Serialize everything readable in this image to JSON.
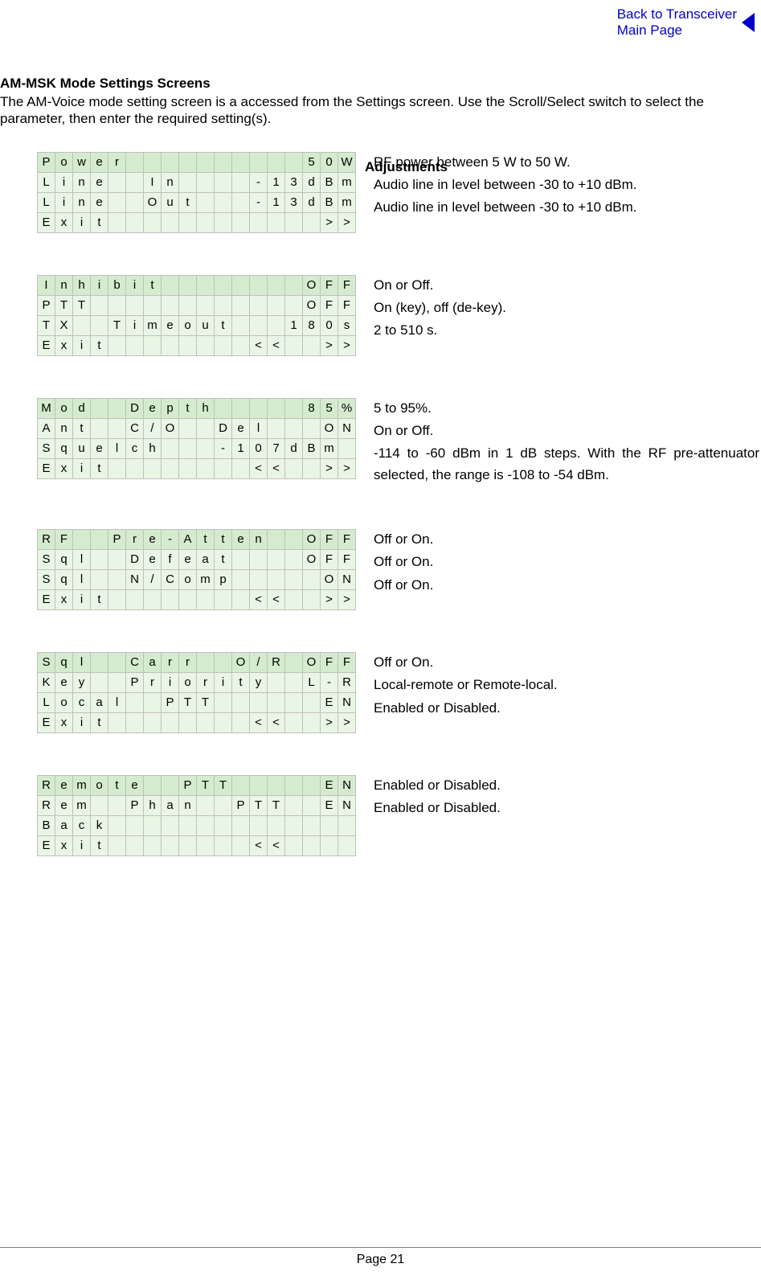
{
  "nav": {
    "back_line1": "Back to Transceiver",
    "back_line2": "Main Page"
  },
  "header": {
    "title": "AM-MSK Mode Settings Screens",
    "intro": "The AM-Voice mode setting screen is a accessed from the Settings screen. Use the Scroll/Select switch to select the parameter, then enter the required setting(s)."
  },
  "adjustments_label": "Adjustments",
  "screens": [
    {
      "rows": [
        "Power          50W",
        "Line  In    -13dBm",
        "Line  Out   -13dBm",
        "Exit            >>"
      ],
      "desc": [
        "RF power between 5 W to 50 W.",
        "Audio line in level between -30 to +10 dBm.",
        "Audio line in level between -30 to +10 dBm."
      ]
    },
    {
      "rows": [
        "Inhibit        OFF",
        "PTT            OFF",
        "TX  Timeout   180s",
        "Exit        <<  >>"
      ],
      "desc": [
        "On or Off.",
        "On (key), off (de-key).",
        "2 to 510 s."
      ]
    },
    {
      "rows": [
        "Mod  Depth     85%",
        "Ant  C/O  Del   ON",
        "Squelch   -107dBm ",
        "Exit        <<  >>"
      ],
      "desc": [
        "5 to 95%.",
        "On or Off.",
        "-114 to -60 dBm in 1 dB steps. With the RF pre-attenuator selected, the range is -108 to -54 dBm."
      ]
    },
    {
      "rows": [
        "RF  Pre-Atten  OFF",
        "Sql  Defeat    OFF",
        "Sql  N/Comp     ON",
        "Exit        <<  >>"
      ],
      "desc": [
        "Off or On.",
        "Off or On.",
        "Off or On."
      ]
    },
    {
      "rows": [
        "Sql  Carr  O/R OFF",
        "Key  Priority  L-R",
        "Local  PTT      EN",
        "Exit        <<  >>"
      ],
      "desc": [
        "Off or On.",
        "Local-remote or Remote-local.",
        "Enabled or Disabled."
      ]
    },
    {
      "rows": [
        "Remote  PTT     EN",
        "Rem  Phan  PTT  EN",
        "Back              ",
        "Exit        <<    "
      ],
      "desc": [
        "Enabled or Disabled.",
        "Enabled or Disabled."
      ]
    }
  ],
  "page_number": "Page 21"
}
